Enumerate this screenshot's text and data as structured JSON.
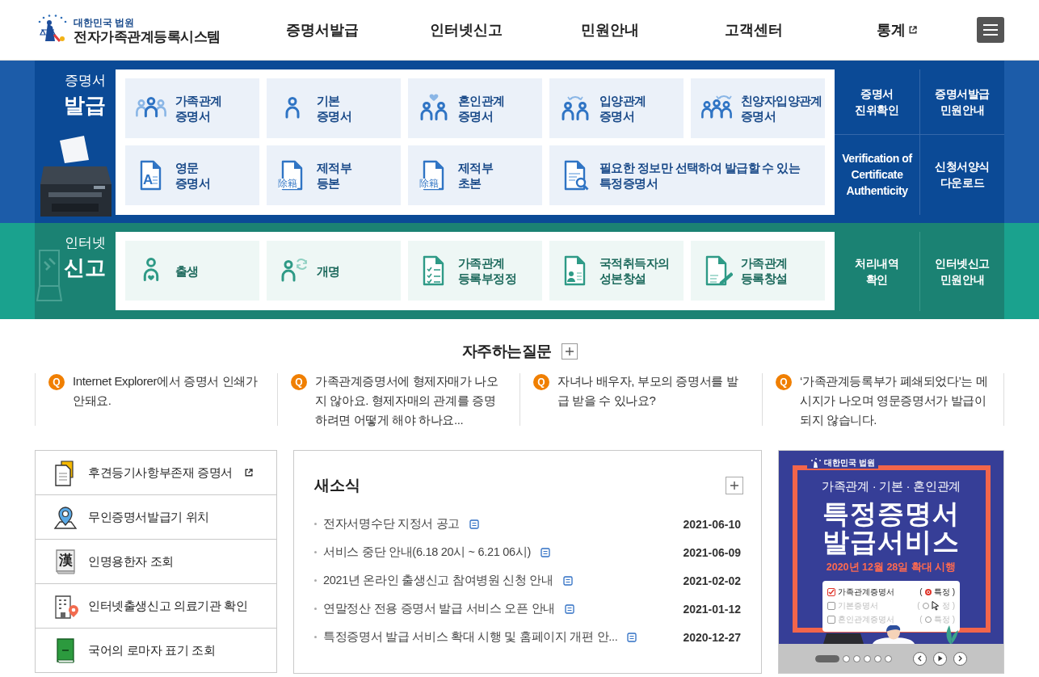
{
  "header": {
    "org": "대한민국 법원",
    "title": "전자가족관계등록시스템",
    "nav": [
      {
        "label": "증명서발급",
        "external": false
      },
      {
        "label": "인터넷신고",
        "external": false
      },
      {
        "label": "민원안내",
        "external": false
      },
      {
        "label": "고객센터",
        "external": false
      },
      {
        "label": "통계",
        "external": true
      }
    ]
  },
  "issue": {
    "title": [
      "증명서",
      "발급"
    ],
    "tiles": [
      {
        "lines": [
          "가족관계",
          "증명서"
        ],
        "wide": false
      },
      {
        "lines": [
          "기본",
          "증명서"
        ],
        "wide": false
      },
      {
        "lines": [
          "혼인관계",
          "증명서"
        ],
        "wide": false
      },
      {
        "lines": [
          "입양관계",
          "증명서"
        ],
        "wide": false
      },
      {
        "lines": [
          "친양자입양관계",
          "증명서"
        ],
        "wide": false
      },
      {
        "lines": [
          "영문",
          "증명서"
        ],
        "glyph": "A",
        "wide": false
      },
      {
        "lines": [
          "제적부",
          "등본"
        ],
        "glyph": "除籍",
        "wide": false
      },
      {
        "lines": [
          "제적부",
          "초본"
        ],
        "glyph": "除籍",
        "wide": false
      },
      {
        "lines": [
          "필요한 정보만 선택하여 발급할 수 있는",
          "특정증명서"
        ],
        "wide": true
      }
    ],
    "links": [
      {
        "lines": [
          "증명서",
          "진위확인"
        ]
      },
      {
        "lines": [
          "증명서발급",
          "민원안내"
        ]
      },
      {
        "lines": [
          "Verification of",
          "Certificate",
          "Authenticity"
        ]
      },
      {
        "lines": [
          "신청서양식",
          "다운로드"
        ]
      }
    ]
  },
  "report": {
    "title": [
      "인터넷",
      "신고"
    ],
    "tiles": [
      {
        "lines": [
          "출생"
        ],
        "wide": false
      },
      {
        "lines": [
          "개명"
        ],
        "wide": false
      },
      {
        "lines": [
          "가족관계",
          "등록부정정"
        ],
        "wide": false
      },
      {
        "lines": [
          "국적취득자의",
          "성본창설"
        ],
        "wide": false
      },
      {
        "lines": [
          "가족관계",
          "등록창설"
        ],
        "wide": false
      }
    ],
    "links": [
      {
        "lines": [
          "처리내역",
          "확인"
        ]
      },
      {
        "lines": [
          "인터넷신고",
          "민원안내"
        ]
      }
    ]
  },
  "faq": {
    "title": "자주하는질문",
    "items": [
      {
        "badge": "Q",
        "text": "Internet Explorer에서 증명서 인쇄가 안돼요."
      },
      {
        "badge": "Q",
        "text": "가족관계증명서에 형제자매가 나오지 않아요. 형제자매의 관계를 증명하려면 어떻게 해야 하나요..."
      },
      {
        "badge": "Q",
        "text": "자녀나 배우자, 부모의 증명서를 발급 받을 수 있나요?"
      },
      {
        "badge": "Q",
        "text": "‘가족관계등록부가 폐쇄되었다’는 메시지가 나오며 영문증명서가 발급이 되지 않습니다."
      }
    ]
  },
  "quick_links": [
    {
      "label": "후견등기사항부존재 증명서",
      "external": true
    },
    {
      "label": "무인증명서발급기 위치",
      "external": false
    },
    {
      "label": "인명용한자 조회",
      "glyph": "漢",
      "external": false
    },
    {
      "label": "인터넷출생신고 의료기관 확인",
      "external": false
    },
    {
      "label": "국어의 로마자 표기 조회",
      "external": false
    }
  ],
  "news": {
    "title": "새소식",
    "items": [
      {
        "title": "전자서명수단 지정서 공고",
        "date": "2021-06-10"
      },
      {
        "title": "서비스 중단 안내(6.18 20시 ~ 6.21 06시)",
        "date": "2021-06-09"
      },
      {
        "title": "2021년 온라인 출생신고 참여병원 신청 안내",
        "date": "2021-02-02"
      },
      {
        "title": "연말정산 전용 증명서 발급 서비스 오픈 안내",
        "date": "2021-01-12"
      },
      {
        "title": "특정증명서 발급 서비스 확대 시행 및 홈페이지 개편 안...",
        "date": "2020-12-27"
      }
    ]
  },
  "banner": {
    "org": "대한민국 법원",
    "subtitle": "가족관계 · 기본 · 혼인관계",
    "headline": [
      "특정증명서",
      "발급서비스"
    ],
    "date_line": "2020년 12월 28일 확대 시행",
    "options": [
      {
        "label": "가족관계증명서",
        "checked": true,
        "open": "(",
        "option": "특정",
        "close": ")",
        "selected": true
      },
      {
        "label": "기본증명서",
        "checked": false,
        "open": "(",
        "option": "정",
        "close": ")",
        "selected": false
      },
      {
        "label": "혼인관계증명서",
        "checked": false,
        "open": "(",
        "option": "특정",
        "close": ")",
        "selected": false
      }
    ],
    "slides": [
      {
        "selected": true
      },
      {
        "selected": false
      },
      {
        "selected": false
      },
      {
        "selected": false
      },
      {
        "selected": false
      },
      {
        "selected": false
      }
    ]
  }
}
